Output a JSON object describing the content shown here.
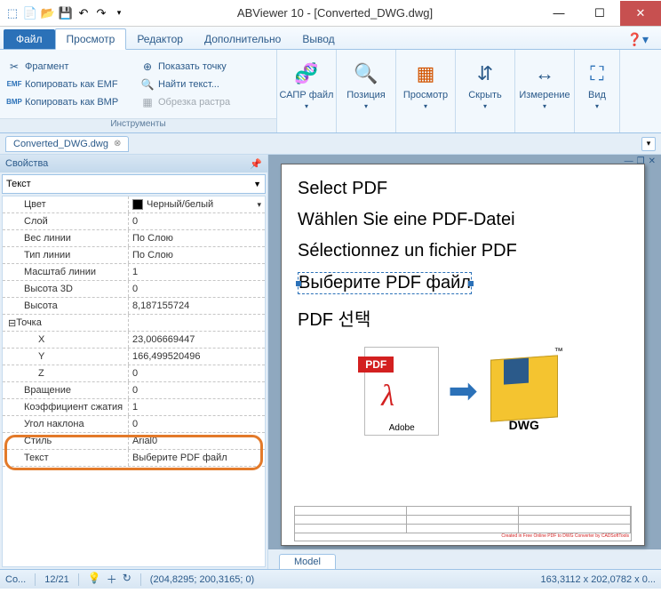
{
  "window": {
    "title": "ABViewer 10 - [Converted_DWG.dwg]"
  },
  "tabs": {
    "file": "Файл",
    "items": [
      "Просмотр",
      "Редактор",
      "Дополнительно",
      "Вывод"
    ],
    "active": 0
  },
  "ribbon": {
    "group1_label": "Инструменты",
    "col1": [
      {
        "icon": "✂",
        "label": "Фрагмент"
      },
      {
        "icon": "EMF",
        "label": "Копировать как EMF"
      },
      {
        "icon": "BMP",
        "label": "Копировать как BMP"
      }
    ],
    "col2": [
      {
        "icon": "⊕",
        "label": "Показать точку"
      },
      {
        "icon": "🔍",
        "label": "Найти текст..."
      },
      {
        "icon": "▦",
        "label": "Обрезка растра",
        "disabled": true
      }
    ],
    "big": [
      {
        "icon": "⚙",
        "label": "САПР файл"
      },
      {
        "icon": "⬚",
        "label": "Позиция"
      },
      {
        "icon": "▦",
        "label": "Просмотр"
      },
      {
        "icon": "↕",
        "label": "Скрыть"
      },
      {
        "icon": "↔",
        "label": "Измерение"
      },
      {
        "icon": "⛶",
        "label": "Вид"
      }
    ]
  },
  "doctab": {
    "name": "Converted_DWG.dwg"
  },
  "properties": {
    "panel_title": "Свойства",
    "category": "Текст",
    "rows": [
      {
        "k": "Цвет",
        "v": "Черный/белый",
        "type": "select"
      },
      {
        "k": "Слой",
        "v": "0"
      },
      {
        "k": "Вес линии",
        "v": "По Слою"
      },
      {
        "k": "Тип линии",
        "v": "По Слою"
      },
      {
        "k": "Масштаб линии",
        "v": "1"
      },
      {
        "k": "Высота 3D",
        "v": "0"
      },
      {
        "k": "Высота",
        "v": "8,187155724"
      },
      {
        "k": "Точка",
        "v": "",
        "group": true
      },
      {
        "k": "X",
        "v": "23,006669447",
        "indent": true
      },
      {
        "k": "Y",
        "v": "166,499520496",
        "indent": true
      },
      {
        "k": "Z",
        "v": "0",
        "indent": true
      },
      {
        "k": "Вращение",
        "v": "0"
      },
      {
        "k": "Коэффициент сжатия",
        "v": "1"
      },
      {
        "k": "Угол наклона",
        "v": "0"
      },
      {
        "k": "Стиль",
        "v": "Arial0",
        "hl": true
      },
      {
        "k": "Текст",
        "v": "Выберите PDF файл",
        "hl": true
      }
    ]
  },
  "canvas": {
    "lines": [
      "Select PDF",
      "Wählen Sie eine PDF-Datei",
      "Sélectionnez un fichier PDF",
      "Выберите PDF файл",
      "PDF 선택"
    ],
    "selected_line": 3,
    "pdf_label": "PDF",
    "adobe_label": "Adobe",
    "dwg_label": "DWG",
    "tm": "™",
    "credit": "Created in Free Online PDF to DWG Converter by CADSoftTools"
  },
  "model_tab": "Model",
  "status": {
    "left1": "Co...",
    "left2": "12/21",
    "coords": "(204,8295; 200,3165; 0)",
    "right": "163,3112 x 202,0782 x 0..."
  }
}
